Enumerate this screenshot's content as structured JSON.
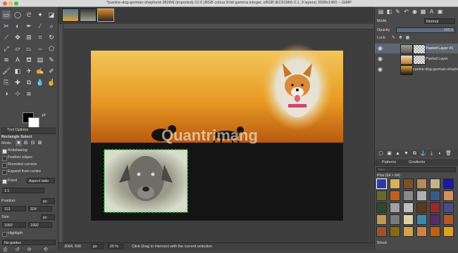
{
  "window": {
    "title": "*[canine-dog-german-shepherd-38284] (imported)-12.0 (RGB colour 8-bit gamma integer, sRGB IEC61966-2.1, 3 layers) 3008x1960 – GIMP"
  },
  "tool_options": {
    "tab_label": "Tool Options",
    "tool_name": "Rectangle Select",
    "mode_label": "Mode:",
    "antialiasing": "Antialiasing",
    "feather_edges": "Feather edges",
    "rounded_corners": "Rounded corners",
    "expand_from_centre": "Expand from centre",
    "fixed_label": "Fixed",
    "fixed_value": "Aspect ratio",
    "ratio_value": "1:1",
    "position_label": "Position:",
    "position_unit": "px",
    "position_x": "112",
    "position_y": "324",
    "size_label": "Size:",
    "size_unit": "px",
    "size_w": "1092",
    "size_h": "1092",
    "highlight": "Highlight",
    "guides_value": "No guides"
  },
  "status": {
    "coords": "3084, 696",
    "unit": "px",
    "zoom": "25 %",
    "message": "Click-Drag to intersect with the current selection"
  },
  "canvas": {
    "watermark": "Quantrimang"
  },
  "layers_panel": {
    "mode_label": "Mode",
    "mode_value": "Normal",
    "opacity_label": "Opacity",
    "opacity_value": "100.0",
    "lock_label": "Lock:",
    "layers": [
      {
        "name": "Pasted Layer #1"
      },
      {
        "name": "Pasted Layer"
      },
      {
        "name": "canine-dog-german-shepherd"
      }
    ]
  },
  "patterns_panel": {
    "tab_patterns": "Patterns",
    "tab_gradients": "Gradients",
    "filter_placeholder": "filter",
    "selected_pattern": "Pine (64 × 64)",
    "footer_name": "Wood",
    "pattern_colors": [
      "#2c3aa8",
      "#d8b060",
      "#7a4f2a",
      "#b88a5a",
      "#c7b28a",
      "#1a1a9c",
      "#6a6a2a",
      "#c06020",
      "#8a8a8a",
      "#b0b0b0",
      "#3a5a8a",
      "#d09060",
      "#2a4a2a",
      "#a0a0a0",
      "#c0c0c0",
      "#5a3a1a",
      "#9a2a2a",
      "#4a4a8a",
      "#c09a50",
      "#7a7a7a",
      "#e0d0a0",
      "#3a8ab0",
      "#5a2a6a",
      "#b05a2a",
      "#a0522d",
      "#8b6914",
      "#d2a24c",
      "#cd853f",
      "#c06010",
      "#e0a020"
    ]
  }
}
